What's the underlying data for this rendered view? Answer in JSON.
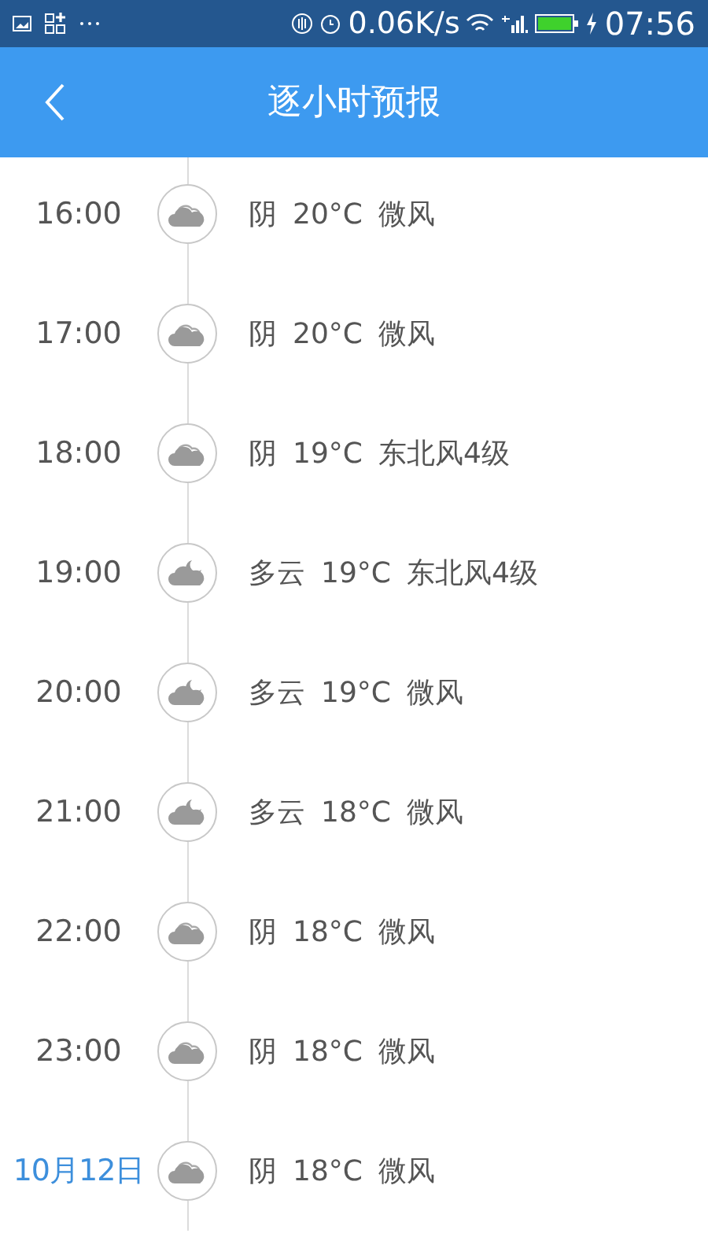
{
  "status_bar": {
    "speed": "0.06K/s",
    "time": "07:56"
  },
  "header": {
    "title": "逐小时预报"
  },
  "hours": [
    {
      "kind": "time",
      "label": "16:00",
      "moon": false,
      "condition": "阴",
      "temp": "20°C",
      "wind": "微风"
    },
    {
      "kind": "time",
      "label": "17:00",
      "moon": false,
      "condition": "阴",
      "temp": "20°C",
      "wind": "微风"
    },
    {
      "kind": "time",
      "label": "18:00",
      "moon": false,
      "condition": "阴",
      "temp": "19°C",
      "wind": "东北风4级"
    },
    {
      "kind": "time",
      "label": "19:00",
      "moon": true,
      "condition": "多云",
      "temp": "19°C",
      "wind": "东北风4级"
    },
    {
      "kind": "time",
      "label": "20:00",
      "moon": true,
      "condition": "多云",
      "temp": "19°C",
      "wind": "微风"
    },
    {
      "kind": "time",
      "label": "21:00",
      "moon": true,
      "condition": "多云",
      "temp": "18°C",
      "wind": "微风"
    },
    {
      "kind": "time",
      "label": "22:00",
      "moon": false,
      "condition": "阴",
      "temp": "18°C",
      "wind": "微风"
    },
    {
      "kind": "time",
      "label": "23:00",
      "moon": false,
      "condition": "阴",
      "temp": "18°C",
      "wind": "微风"
    },
    {
      "kind": "date",
      "label": "10月12日",
      "moon": false,
      "condition": "阴",
      "temp": "18°C",
      "wind": "微风"
    }
  ]
}
